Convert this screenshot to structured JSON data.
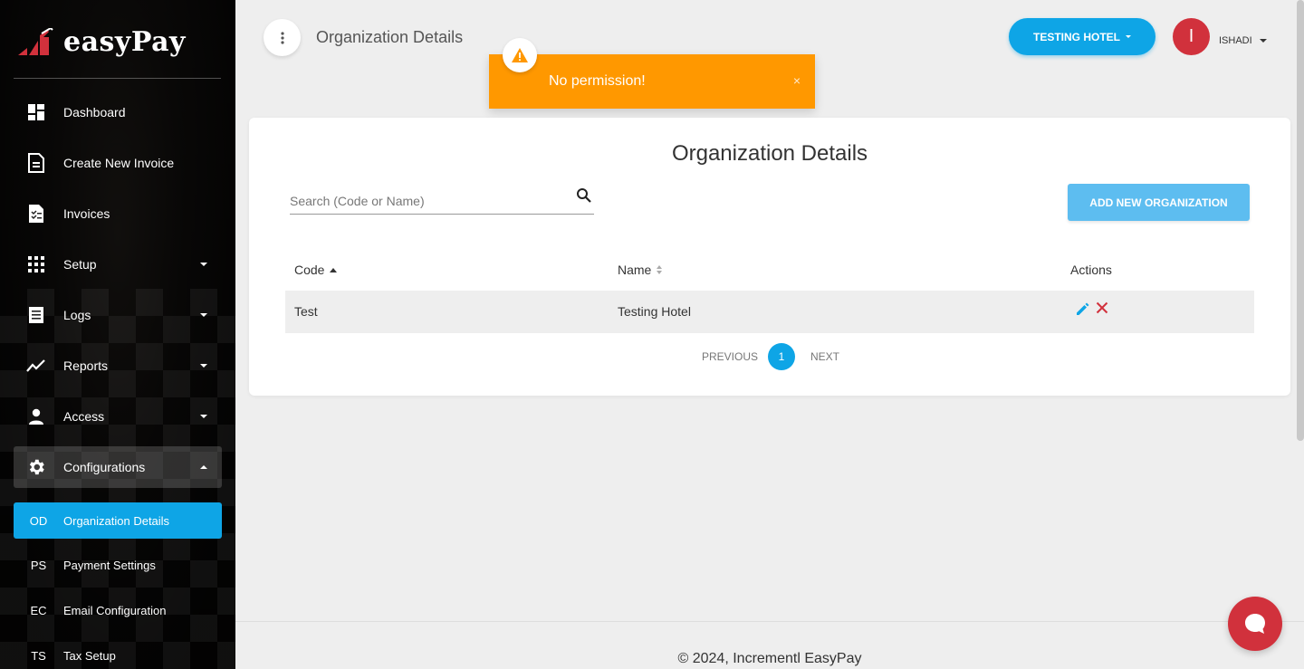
{
  "app": {
    "name": "easyPay"
  },
  "header": {
    "title": "Organization Details",
    "hotel_selector": "TESTING HOTEL",
    "avatar_initial": "I",
    "user_name": "ISHADI"
  },
  "toast": {
    "message": "No permission!",
    "close": "×"
  },
  "sidebar": {
    "items": [
      {
        "label": "Dashboard",
        "icon": "dashboard-icon"
      },
      {
        "label": "Create New Invoice",
        "icon": "document-icon"
      },
      {
        "label": "Invoices",
        "icon": "checklist-icon"
      },
      {
        "label": "Setup",
        "icon": "grid-icon"
      },
      {
        "label": "Logs",
        "icon": "list-icon"
      },
      {
        "label": "Reports",
        "icon": "trending-icon"
      },
      {
        "label": "Access",
        "icon": "person-icon"
      },
      {
        "label": "Configurations",
        "icon": "gear-icon"
      }
    ],
    "subitems": [
      {
        "abbr": "OD",
        "label": "Organization Details"
      },
      {
        "abbr": "PS",
        "label": "Payment Settings"
      },
      {
        "abbr": "EC",
        "label": "Email Configuration"
      },
      {
        "abbr": "TS",
        "label": "Tax Setup"
      }
    ]
  },
  "main": {
    "title": "Organization Details",
    "search_placeholder": "Search (Code or Name)",
    "add_button": "ADD NEW ORGANIZATION",
    "table": {
      "columns": [
        "Code",
        "Name",
        "Actions"
      ],
      "rows": [
        {
          "code": "Test",
          "name": "Testing Hotel"
        }
      ]
    },
    "pagination": {
      "previous": "PREVIOUS",
      "page": "1",
      "next": "NEXT"
    }
  },
  "footer": {
    "text": "© 2024, Incrementl EasyPay"
  },
  "colors": {
    "primary": "#0ea5e6",
    "warning": "#ff9800",
    "danger": "#d1313c"
  }
}
